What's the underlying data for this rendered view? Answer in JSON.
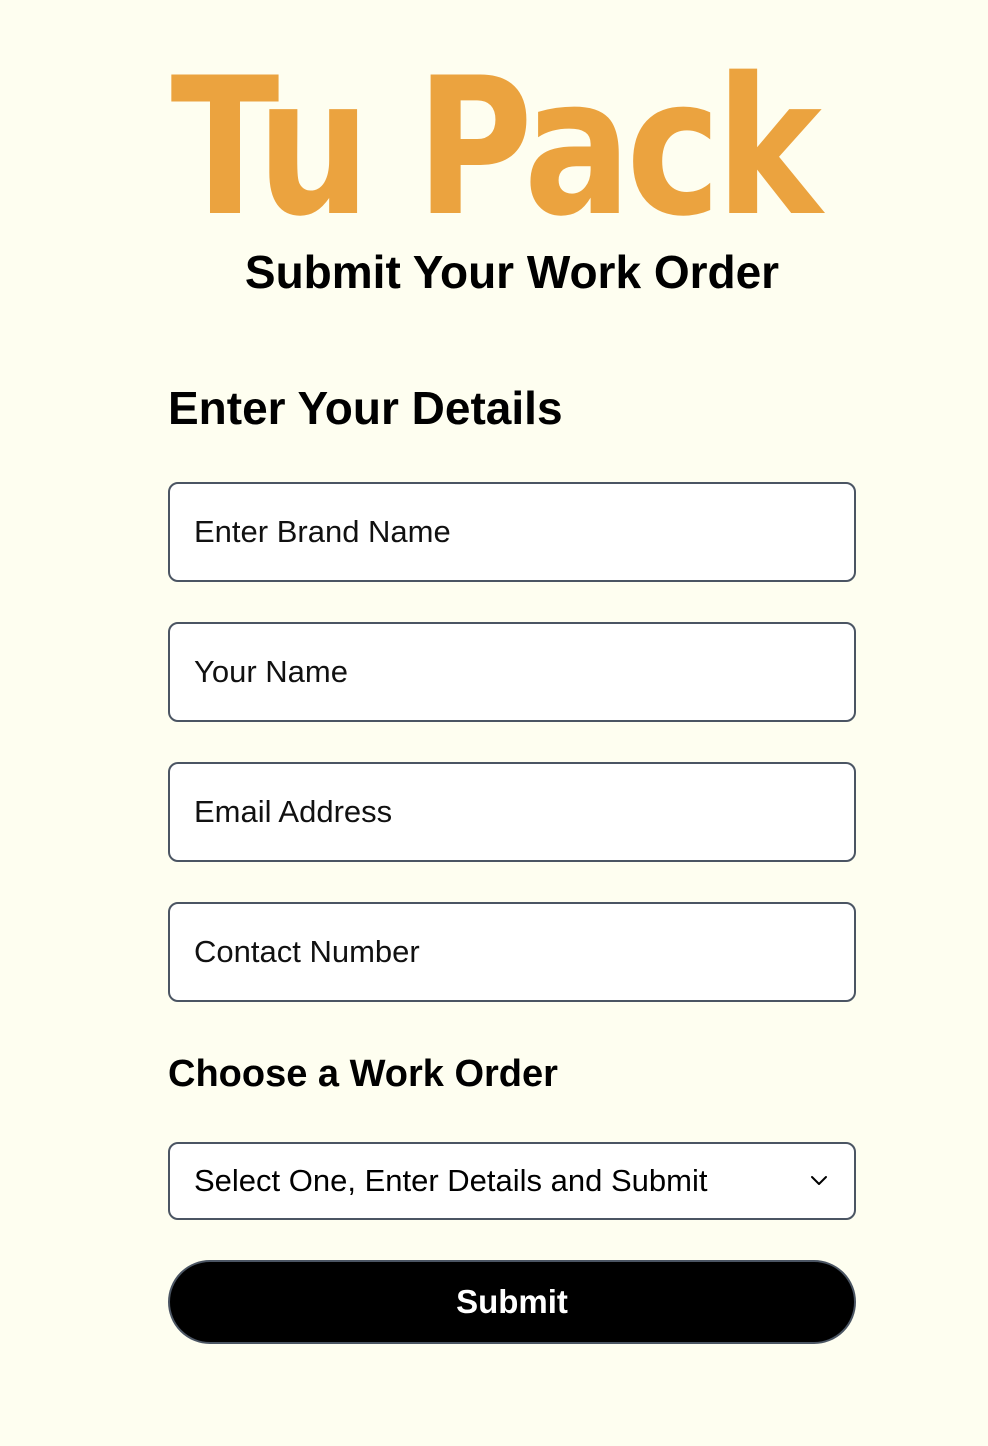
{
  "brand": {
    "logo_text": "Tu Pack",
    "logo_color": "#eba33f"
  },
  "page": {
    "title": "Submit Your Work Order",
    "background": "#fefef0"
  },
  "details_section": {
    "heading": "Enter Your Details",
    "fields": [
      {
        "placeholder": "Enter Brand Name",
        "value": ""
      },
      {
        "placeholder": "Your Name",
        "value": ""
      },
      {
        "placeholder": "Email Address",
        "value": ""
      },
      {
        "placeholder": "Contact Number",
        "value": ""
      }
    ]
  },
  "order_section": {
    "heading": "Choose a Work Order",
    "select": {
      "selected": "Select One, Enter Details and Submit",
      "icon": "chevron-down-icon"
    }
  },
  "submit": {
    "label": "Submit",
    "background": "#000000",
    "text_color": "#ffffff"
  }
}
